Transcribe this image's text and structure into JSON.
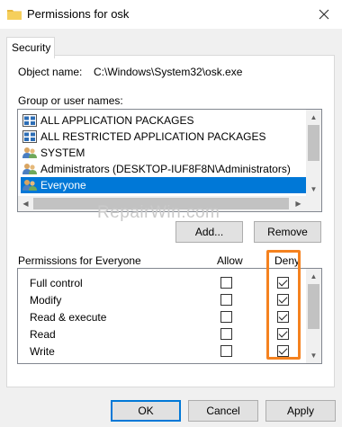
{
  "window": {
    "title": "Permissions for osk"
  },
  "tabs": [
    {
      "label": "Security"
    }
  ],
  "object": {
    "label": "Object name:",
    "value": "C:\\Windows\\System32\\osk.exe"
  },
  "groups": {
    "label": "Group or user names:",
    "items": [
      {
        "name": "ALL APPLICATION PACKAGES",
        "icon": "app-package-icon"
      },
      {
        "name": "ALL RESTRICTED APPLICATION PACKAGES",
        "icon": "app-package-icon"
      },
      {
        "name": "SYSTEM",
        "icon": "users-icon"
      },
      {
        "name": "Administrators (DESKTOP-IUF8F8N\\Administrators)",
        "icon": "users-icon"
      },
      {
        "name": "Everyone",
        "icon": "users-icon",
        "selected": true
      }
    ]
  },
  "buttons": {
    "add": "Add...",
    "remove": "Remove",
    "ok": "OK",
    "cancel": "Cancel",
    "apply": "Apply"
  },
  "watermark": "RepairWin.com",
  "permissions": {
    "header": "Permissions for Everyone",
    "allow_label": "Allow",
    "deny_label": "Deny",
    "rows": [
      {
        "name": "Full control",
        "allow": false,
        "deny": true
      },
      {
        "name": "Modify",
        "allow": false,
        "deny": true
      },
      {
        "name": "Read & execute",
        "allow": false,
        "deny": true
      },
      {
        "name": "Read",
        "allow": false,
        "deny": true
      },
      {
        "name": "Write",
        "allow": false,
        "deny": true
      }
    ]
  },
  "colors": {
    "selection": "#0078d7",
    "highlight": "#f5821f"
  }
}
